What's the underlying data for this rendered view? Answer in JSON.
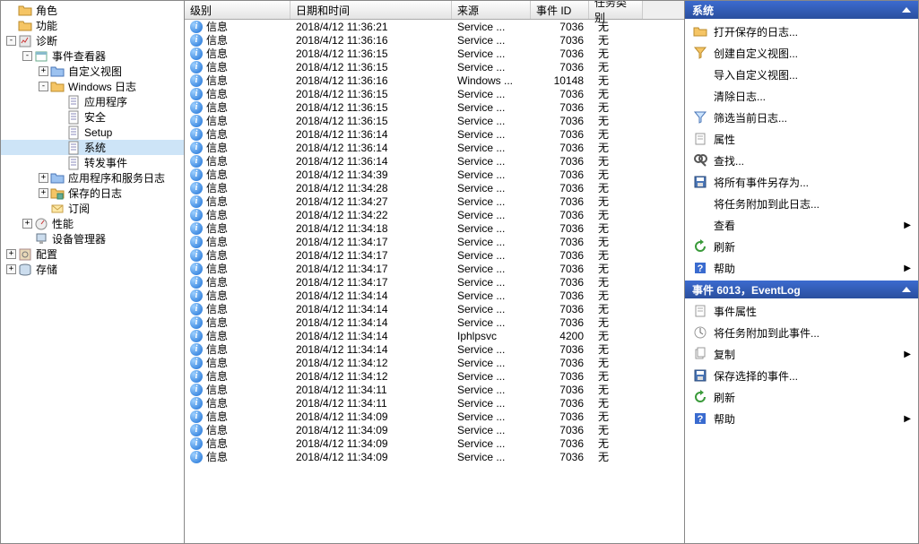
{
  "tree": [
    {
      "depth": 0,
      "exp": "",
      "icon": "folder",
      "label": "角色"
    },
    {
      "depth": 0,
      "exp": "",
      "icon": "folder",
      "label": "功能"
    },
    {
      "depth": 0,
      "exp": "-",
      "icon": "diag",
      "label": "诊断"
    },
    {
      "depth": 1,
      "exp": "-",
      "icon": "eventvwr",
      "label": "事件查看器"
    },
    {
      "depth": 2,
      "exp": "+",
      "icon": "folderblue",
      "label": "自定义视图"
    },
    {
      "depth": 2,
      "exp": "-",
      "icon": "folderyellow",
      "label": "Windows 日志"
    },
    {
      "depth": 3,
      "exp": "",
      "icon": "log",
      "label": "应用程序"
    },
    {
      "depth": 3,
      "exp": "",
      "icon": "log",
      "label": "安全"
    },
    {
      "depth": 3,
      "exp": "",
      "icon": "log",
      "label": "Setup"
    },
    {
      "depth": 3,
      "exp": "",
      "icon": "log",
      "label": "系统",
      "selected": true
    },
    {
      "depth": 3,
      "exp": "",
      "icon": "log",
      "label": "转发事件"
    },
    {
      "depth": 2,
      "exp": "+",
      "icon": "folderblue",
      "label": "应用程序和服务日志"
    },
    {
      "depth": 2,
      "exp": "+",
      "icon": "saved",
      "label": "保存的日志"
    },
    {
      "depth": 2,
      "exp": "",
      "icon": "subscribe",
      "label": "订阅"
    },
    {
      "depth": 1,
      "exp": "+",
      "icon": "perf",
      "label": "性能"
    },
    {
      "depth": 1,
      "exp": "",
      "icon": "device",
      "label": "设备管理器"
    },
    {
      "depth": 0,
      "exp": "+",
      "icon": "config",
      "label": "配置"
    },
    {
      "depth": 0,
      "exp": "+",
      "icon": "storage",
      "label": "存储"
    }
  ],
  "grid": {
    "headers": {
      "level": "级别",
      "date": "日期和时间",
      "source": "来源",
      "id": "事件 ID",
      "cat": "任务类别"
    },
    "rows": [
      {
        "level": "信息",
        "date": "2018/4/12 11:36:21",
        "source": "Service ...",
        "id": "7036",
        "cat": "无"
      },
      {
        "level": "信息",
        "date": "2018/4/12 11:36:16",
        "source": "Service ...",
        "id": "7036",
        "cat": "无"
      },
      {
        "level": "信息",
        "date": "2018/4/12 11:36:15",
        "source": "Service ...",
        "id": "7036",
        "cat": "无"
      },
      {
        "level": "信息",
        "date": "2018/4/12 11:36:15",
        "source": "Service ...",
        "id": "7036",
        "cat": "无"
      },
      {
        "level": "信息",
        "date": "2018/4/12 11:36:16",
        "source": "Windows ...",
        "id": "10148",
        "cat": "无"
      },
      {
        "level": "信息",
        "date": "2018/4/12 11:36:15",
        "source": "Service ...",
        "id": "7036",
        "cat": "无"
      },
      {
        "level": "信息",
        "date": "2018/4/12 11:36:15",
        "source": "Service ...",
        "id": "7036",
        "cat": "无"
      },
      {
        "level": "信息",
        "date": "2018/4/12 11:36:15",
        "source": "Service ...",
        "id": "7036",
        "cat": "无"
      },
      {
        "level": "信息",
        "date": "2018/4/12 11:36:14",
        "source": "Service ...",
        "id": "7036",
        "cat": "无"
      },
      {
        "level": "信息",
        "date": "2018/4/12 11:36:14",
        "source": "Service ...",
        "id": "7036",
        "cat": "无"
      },
      {
        "level": "信息",
        "date": "2018/4/12 11:36:14",
        "source": "Service ...",
        "id": "7036",
        "cat": "无"
      },
      {
        "level": "信息",
        "date": "2018/4/12 11:34:39",
        "source": "Service ...",
        "id": "7036",
        "cat": "无"
      },
      {
        "level": "信息",
        "date": "2018/4/12 11:34:28",
        "source": "Service ...",
        "id": "7036",
        "cat": "无"
      },
      {
        "level": "信息",
        "date": "2018/4/12 11:34:27",
        "source": "Service ...",
        "id": "7036",
        "cat": "无"
      },
      {
        "level": "信息",
        "date": "2018/4/12 11:34:22",
        "source": "Service ...",
        "id": "7036",
        "cat": "无"
      },
      {
        "level": "信息",
        "date": "2018/4/12 11:34:18",
        "source": "Service ...",
        "id": "7036",
        "cat": "无"
      },
      {
        "level": "信息",
        "date": "2018/4/12 11:34:17",
        "source": "Service ...",
        "id": "7036",
        "cat": "无"
      },
      {
        "level": "信息",
        "date": "2018/4/12 11:34:17",
        "source": "Service ...",
        "id": "7036",
        "cat": "无"
      },
      {
        "level": "信息",
        "date": "2018/4/12 11:34:17",
        "source": "Service ...",
        "id": "7036",
        "cat": "无"
      },
      {
        "level": "信息",
        "date": "2018/4/12 11:34:17",
        "source": "Service ...",
        "id": "7036",
        "cat": "无"
      },
      {
        "level": "信息",
        "date": "2018/4/12 11:34:14",
        "source": "Service ...",
        "id": "7036",
        "cat": "无"
      },
      {
        "level": "信息",
        "date": "2018/4/12 11:34:14",
        "source": "Service ...",
        "id": "7036",
        "cat": "无"
      },
      {
        "level": "信息",
        "date": "2018/4/12 11:34:14",
        "source": "Service ...",
        "id": "7036",
        "cat": "无"
      },
      {
        "level": "信息",
        "date": "2018/4/12 11:34:14",
        "source": "Iphlpsvc",
        "id": "4200",
        "cat": "无"
      },
      {
        "level": "信息",
        "date": "2018/4/12 11:34:14",
        "source": "Service ...",
        "id": "7036",
        "cat": "无"
      },
      {
        "level": "信息",
        "date": "2018/4/12 11:34:12",
        "source": "Service ...",
        "id": "7036",
        "cat": "无"
      },
      {
        "level": "信息",
        "date": "2018/4/12 11:34:12",
        "source": "Service ...",
        "id": "7036",
        "cat": "无"
      },
      {
        "level": "信息",
        "date": "2018/4/12 11:34:11",
        "source": "Service ...",
        "id": "7036",
        "cat": "无"
      },
      {
        "level": "信息",
        "date": "2018/4/12 11:34:11",
        "source": "Service ...",
        "id": "7036",
        "cat": "无"
      },
      {
        "level": "信息",
        "date": "2018/4/12 11:34:09",
        "source": "Service ...",
        "id": "7036",
        "cat": "无"
      },
      {
        "level": "信息",
        "date": "2018/4/12 11:34:09",
        "source": "Service ...",
        "id": "7036",
        "cat": "无"
      },
      {
        "level": "信息",
        "date": "2018/4/12 11:34:09",
        "source": "Service ...",
        "id": "7036",
        "cat": "无"
      },
      {
        "level": "信息",
        "date": "2018/4/12 11:34:09",
        "source": "Service ...",
        "id": "7036",
        "cat": "无"
      }
    ]
  },
  "actions": {
    "section1": {
      "title": "系统",
      "items": [
        {
          "icon": "open",
          "label": "打开保存的日志..."
        },
        {
          "icon": "filter",
          "label": "创建自定义视图..."
        },
        {
          "icon": "",
          "label": "导入自定义视图..."
        },
        {
          "icon": "",
          "label": "清除日志..."
        },
        {
          "icon": "funnel",
          "label": "筛选当前日志..."
        },
        {
          "icon": "props",
          "label": "属性"
        },
        {
          "icon": "find",
          "label": "查找..."
        },
        {
          "icon": "save",
          "label": "将所有事件另存为..."
        },
        {
          "icon": "",
          "label": "将任务附加到此日志..."
        },
        {
          "icon": "",
          "label": "查看",
          "sub": true
        },
        {
          "icon": "refresh",
          "label": "刷新"
        },
        {
          "icon": "help",
          "label": "帮助",
          "sub": true
        }
      ]
    },
    "section2": {
      "title": "事件 6013，EventLog",
      "items": [
        {
          "icon": "props",
          "label": "事件属性"
        },
        {
          "icon": "attach",
          "label": "将任务附加到此事件..."
        },
        {
          "icon": "copy",
          "label": "复制",
          "sub": true
        },
        {
          "icon": "save",
          "label": "保存选择的事件..."
        },
        {
          "icon": "refresh",
          "label": "刷新"
        },
        {
          "icon": "help",
          "label": "帮助",
          "sub": true
        }
      ]
    }
  }
}
